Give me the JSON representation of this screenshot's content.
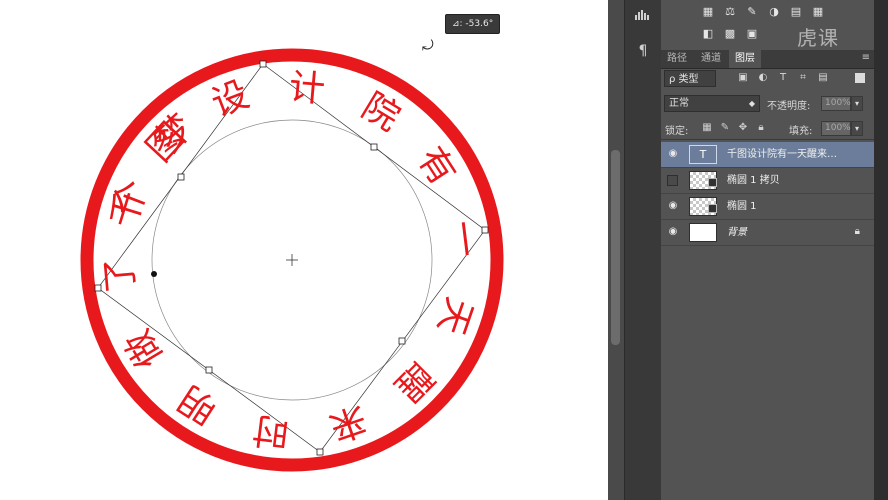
{
  "canvas": {
    "rotation_readout": "⊿: -53.6°",
    "stamp_text": "千图设计院有一天醒来时明做了个梦",
    "stamp_color": "#e8191c"
  },
  "toolstrip": {
    "icons": [
      "histogram-icon",
      "paragraph-icon"
    ],
    "paragraph_glyph": "¶"
  },
  "panel": {
    "watermark": "虎课",
    "tabs": [
      {
        "label": "路径"
      },
      {
        "label": "通道"
      },
      {
        "label": "图层"
      }
    ],
    "filter": {
      "kind_label": "ρ 类型"
    },
    "blend": {
      "mode": "正常",
      "opacity_label": "不透明度:",
      "opacity_value": "100%"
    },
    "lock": {
      "label": "锁定:",
      "fill_label": "填充:",
      "fill_value": "100%"
    },
    "layers": [
      {
        "name": "千图设计院有一天醒来…",
        "visible": true,
        "selected": true,
        "type": "text"
      },
      {
        "name": "椭圆 1 拷贝",
        "visible": false,
        "selected": false,
        "type": "shape"
      },
      {
        "name": "椭圆 1",
        "visible": true,
        "selected": false,
        "type": "shape"
      },
      {
        "name": "背景",
        "visible": true,
        "selected": false,
        "type": "background",
        "locked": true
      }
    ]
  },
  "colors": {
    "panel_bg": "#535353",
    "selected_layer": "#6b7d9a",
    "stamp_red": "#e8191c"
  }
}
